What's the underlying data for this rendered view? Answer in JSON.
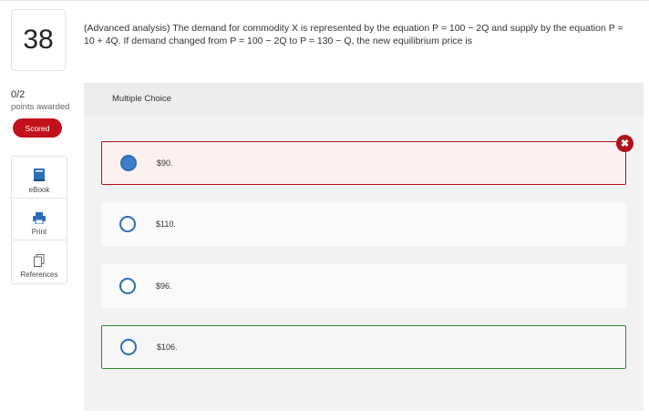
{
  "question": {
    "number": "38",
    "text": "(Advanced analysis) The demand for commodity X is represented by the equation P = 100 − 2Q and supply by the equation P = 10 + 4Q. If demand changed from P = 100 − 2Q to P = 130 − Q, the new equilibrium price is"
  },
  "score": {
    "value": "0/2",
    "label": "points awarded",
    "badge": "Scored"
  },
  "tools": [
    {
      "label": "eBook",
      "icon": "book-icon"
    },
    {
      "label": "Print",
      "icon": "printer-icon"
    },
    {
      "label": "References",
      "icon": "document-icon"
    }
  ],
  "panel": {
    "title": "Multiple Choice"
  },
  "options": [
    {
      "label": "$90.",
      "state": "selected-wrong"
    },
    {
      "label": "$110.",
      "state": "none"
    },
    {
      "label": "$96.",
      "state": "none"
    },
    {
      "label": "$106.",
      "state": "correct"
    }
  ],
  "colors": {
    "wrong": "#b3111b",
    "correct": "#2d8a2d",
    "accent": "#2a6ebb"
  }
}
